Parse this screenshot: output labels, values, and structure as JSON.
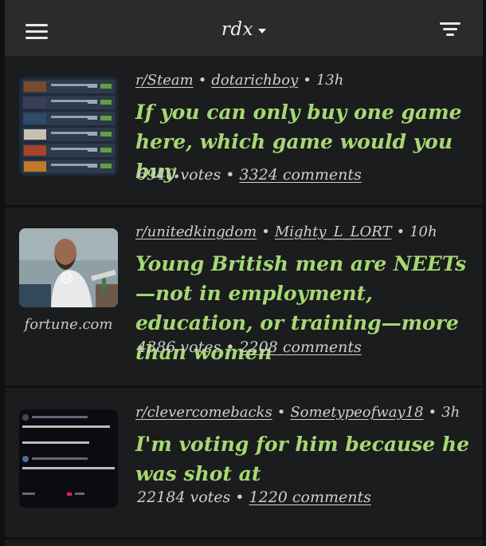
{
  "header": {
    "title": "rdx"
  },
  "posts": [
    {
      "subreddit": "r/Steam",
      "author": "dotarichboy",
      "age": "13h",
      "title": "If you can only buy one game here, which game would you buy.",
      "votes": "6940 votes",
      "comments": "3324 comments",
      "domain": ""
    },
    {
      "subreddit": "r/unitedkingdom",
      "author": "Mighty_L_LORT",
      "age": "10h",
      "title": "Young British men are NEETs—not in employment, education, or training—more than women",
      "votes": "4386 votes",
      "comments": "2208 comments",
      "domain": "fortune.com"
    },
    {
      "subreddit": "r/clevercomebacks",
      "author": "Sometypeofway18",
      "age": "3h",
      "title": "I'm voting for him because he was shot at",
      "votes": "22184 votes",
      "comments": "1220 comments",
      "domain": ""
    }
  ],
  "colors": {
    "background": "#1b1c1d",
    "header": "#2a2b2c",
    "title_accent": "#a6d873",
    "text": "#cfcfcf"
  },
  "icons": {
    "menu": "hamburger-icon",
    "filter": "filter-lines-icon",
    "link": "globe-link-icon"
  }
}
